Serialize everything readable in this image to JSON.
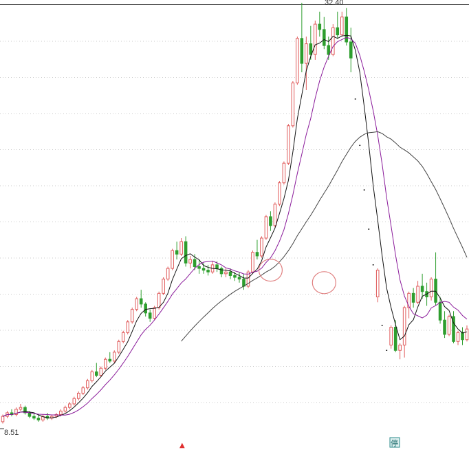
{
  "chart_data": {
    "type": "candlestick",
    "title": "",
    "xlabel": "",
    "ylabel": "",
    "ylim": [
      8.51,
      32.4
    ],
    "grid": true,
    "labels": {
      "high": "32.40",
      "low": "8.51"
    },
    "markers": {
      "limit_up": "▲",
      "suspension": "停"
    },
    "colors": {
      "up": "#e05a5a",
      "down": "#2e9e2e",
      "ma_short": "#111111",
      "ma_mid": "#8a1a9a",
      "ma_long": "#444444",
      "circle": "#e08080",
      "grid": "#c8c8c8"
    },
    "series": [
      {
        "values": [
          [
            8.9,
            9.3,
            8.8,
            9.2
          ],
          [
            9.2,
            9.5,
            9.1,
            9.4
          ],
          [
            9.4,
            9.6,
            9.2,
            9.3
          ],
          [
            9.3,
            9.7,
            9.2,
            9.6
          ],
          [
            9.6,
            9.9,
            9.5,
            9.7
          ],
          [
            9.7,
            9.8,
            9.3,
            9.4
          ],
          [
            9.4,
            9.5,
            9.1,
            9.2
          ],
          [
            9.2,
            9.4,
            9.0,
            9.1
          ],
          [
            9.1,
            9.3,
            8.9,
            9.0
          ],
          [
            9.0,
            9.3,
            8.9,
            9.2
          ],
          [
            9.2,
            9.4,
            9.0,
            9.1
          ],
          [
            9.1,
            9.3,
            9.0,
            9.2
          ],
          [
            9.2,
            9.4,
            9.1,
            9.3
          ],
          [
            9.3,
            9.6,
            9.2,
            9.5
          ],
          [
            9.5,
            9.8,
            9.4,
            9.7
          ],
          [
            9.7,
            10.0,
            9.6,
            9.9
          ],
          [
            9.9,
            10.3,
            9.8,
            10.2
          ],
          [
            10.2,
            10.6,
            10.1,
            10.5
          ],
          [
            10.5,
            10.9,
            10.4,
            10.8
          ],
          [
            10.8,
            11.3,
            10.7,
            11.2
          ],
          [
            11.2,
            11.8,
            11.1,
            11.7
          ],
          [
            11.7,
            12.2,
            11.4,
            11.5
          ],
          [
            11.5,
            12.0,
            11.4,
            11.9
          ],
          [
            11.9,
            12.5,
            11.8,
            12.4
          ],
          [
            12.4,
            12.8,
            12.2,
            12.3
          ],
          [
            12.3,
            12.9,
            12.2,
            12.8
          ],
          [
            12.8,
            13.5,
            12.7,
            13.4
          ],
          [
            13.4,
            14.0,
            13.3,
            13.9
          ],
          [
            13.9,
            14.6,
            13.8,
            14.5
          ],
          [
            14.5,
            15.3,
            14.4,
            15.2
          ],
          [
            15.2,
            15.9,
            15.1,
            15.8
          ],
          [
            15.8,
            16.3,
            15.3,
            15.5
          ],
          [
            15.5,
            15.6,
            14.8,
            15.0
          ],
          [
            15.0,
            15.2,
            14.5,
            14.7
          ],
          [
            14.7,
            15.4,
            14.6,
            15.3
          ],
          [
            15.3,
            16.2,
            15.2,
            16.1
          ],
          [
            16.1,
            17.0,
            16.0,
            16.9
          ],
          [
            16.9,
            17.6,
            16.8,
            17.5
          ],
          [
            17.5,
            18.6,
            17.4,
            18.5
          ],
          [
            18.5,
            19.0,
            18.0,
            18.3
          ],
          [
            18.3,
            19.2,
            18.2,
            19.0
          ],
          [
            19.0,
            19.3,
            17.6,
            17.8
          ],
          [
            17.8,
            18.2,
            17.5,
            18.0
          ],
          [
            18.0,
            18.3,
            17.4,
            17.6
          ],
          [
            17.6,
            18.0,
            17.2,
            17.5
          ],
          [
            17.5,
            17.8,
            17.2,
            17.4
          ],
          [
            17.4,
            17.7,
            17.1,
            17.3
          ],
          [
            17.3,
            17.9,
            17.2,
            17.7
          ],
          [
            17.7,
            17.9,
            17.3,
            17.5
          ],
          [
            17.5,
            17.6,
            17.0,
            17.2
          ],
          [
            17.2,
            17.5,
            17.0,
            17.3
          ],
          [
            17.3,
            17.5,
            16.9,
            17.1
          ],
          [
            17.1,
            17.3,
            16.8,
            17.0
          ],
          [
            17.0,
            17.3,
            16.7,
            16.9
          ],
          [
            16.9,
            17.2,
            16.3,
            16.5
          ],
          [
            16.5,
            17.4,
            16.4,
            17.3
          ],
          [
            17.3,
            18.5,
            17.2,
            18.4
          ],
          [
            18.4,
            19.1,
            18.0,
            18.2
          ],
          [
            18.2,
            19.3,
            18.1,
            19.2
          ],
          [
            19.2,
            20.5,
            19.1,
            20.4
          ],
          [
            20.4,
            20.7,
            19.6,
            19.9
          ],
          [
            19.9,
            21.2,
            19.8,
            21.1
          ],
          [
            21.1,
            22.4,
            21.0,
            22.3
          ],
          [
            22.3,
            23.5,
            22.2,
            23.4
          ],
          [
            23.4,
            25.6,
            23.3,
            25.5
          ],
          [
            25.5,
            28.0,
            25.4,
            27.9
          ],
          [
            27.9,
            30.5,
            27.8,
            30.4
          ],
          [
            30.4,
            32.4,
            28.5,
            29.0
          ],
          [
            29.0,
            30.5,
            27.5,
            30.1
          ],
          [
            30.1,
            31.1,
            29.2,
            29.5
          ],
          [
            29.5,
            31.4,
            29.2,
            31.2
          ],
          [
            31.2,
            31.9,
            30.5,
            30.9
          ],
          [
            30.9,
            31.6,
            29.8,
            30.0
          ],
          [
            30.0,
            30.5,
            29.2,
            29.5
          ],
          [
            29.5,
            31.2,
            29.4,
            31.0
          ],
          [
            31.0,
            31.9,
            30.4,
            30.6
          ],
          [
            30.6,
            31.9,
            30.5,
            31.6
          ],
          [
            31.6,
            32.1,
            30.0,
            30.2
          ],
          [
            30.2,
            31.0,
            28.5,
            29.3
          ],
          [
            27.0,
            27.0,
            27.0,
            27.0
          ],
          [
            24.4,
            24.4,
            24.4,
            24.4
          ],
          [
            21.9,
            21.9,
            21.9,
            21.9
          ],
          [
            19.7,
            19.7,
            19.7,
            19.7
          ],
          [
            17.7,
            17.7,
            17.7,
            17.7
          ],
          [
            15.9,
            17.5,
            15.6,
            17.4
          ],
          [
            14.3,
            14.3,
            14.3,
            14.3
          ],
          [
            12.9,
            12.9,
            12.9,
            12.9
          ],
          [
            13.2,
            14.3,
            13.0,
            14.2
          ],
          [
            14.2,
            14.6,
            12.8,
            12.9
          ],
          [
            12.9,
            13.3,
            12.4,
            13.2
          ],
          [
            13.2,
            15.4,
            12.5,
            15.3
          ],
          [
            15.3,
            16.2,
            14.7,
            16.1
          ],
          [
            16.1,
            16.4,
            15.3,
            15.6
          ],
          [
            15.6,
            16.8,
            15.5,
            16.5
          ],
          [
            16.5,
            17.2,
            15.8,
            16.2
          ],
          [
            16.2,
            16.7,
            15.4,
            15.9
          ],
          [
            15.9,
            17.0,
            15.7,
            16.9
          ],
          [
            16.9,
            18.4,
            15.4,
            15.6
          ],
          [
            15.6,
            15.9,
            14.4,
            14.6
          ],
          [
            14.6,
            15.1,
            13.6,
            13.8
          ],
          [
            13.8,
            14.9,
            13.7,
            14.8
          ],
          [
            14.8,
            15.1,
            13.3,
            13.4
          ],
          [
            13.4,
            14.0,
            13.2,
            13.9
          ],
          [
            13.9,
            14.2,
            13.2,
            13.5
          ],
          [
            13.5,
            14.3,
            13.4,
            14.1
          ]
        ]
      }
    ],
    "annotations": [
      {
        "label": "circle",
        "x": 60,
        "y": 17.4
      },
      {
        "label": "circle",
        "x": 72,
        "y": 16.7
      }
    ]
  }
}
